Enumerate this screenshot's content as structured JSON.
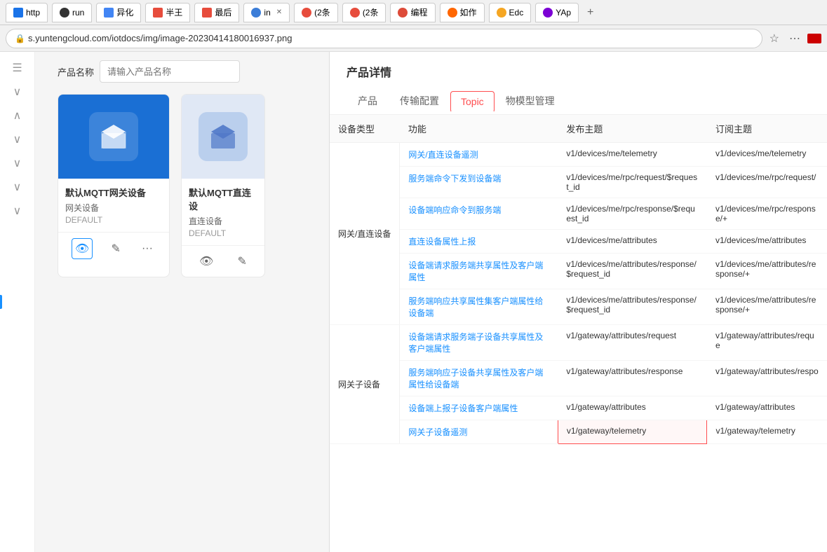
{
  "browser": {
    "tabs": [
      {
        "icon": "http",
        "label": "http",
        "closable": false
      },
      {
        "icon": "github",
        "label": "run",
        "closable": false
      },
      {
        "icon": "doc",
        "label": "异化",
        "closable": false
      },
      {
        "icon": "k",
        "label": "半王",
        "closable": false
      },
      {
        "icon": "k",
        "label": "最后",
        "closable": false
      },
      {
        "icon": "globe",
        "label": "in",
        "closable": true
      },
      {
        "icon": "c1",
        "label": "(2条",
        "closable": false
      },
      {
        "icon": "c1",
        "label": "(2条",
        "closable": false
      },
      {
        "icon": "g",
        "label": "编程",
        "closable": false
      },
      {
        "icon": "m",
        "label": "如作",
        "closable": false
      },
      {
        "icon": "edc",
        "label": "Edc",
        "closable": false
      },
      {
        "icon": "y",
        "label": "YAp",
        "closable": false
      }
    ],
    "address": "s.yuntengcloud.com/iotdocs/img/image-20230414180016937.png"
  },
  "left_panel": {
    "form_label": "产品名称",
    "form_placeholder": "请输入产品名称",
    "card1": {
      "title": "默认MQTT网关设备",
      "sub": "网关设备",
      "tag": "DEFAULT"
    },
    "card2": {
      "title": "默认MQTT直连设",
      "sub": "直连设备",
      "tag": "DEFAULT"
    }
  },
  "right_panel": {
    "title": "产品详情",
    "tabs": [
      {
        "label": "产品",
        "active": false
      },
      {
        "label": "传输配置",
        "active": false
      },
      {
        "label": "Topic",
        "active": true
      },
      {
        "label": "物模型管理",
        "active": false
      }
    ],
    "table": {
      "columns": [
        "设备类型",
        "功能",
        "发布主题",
        "订阅主题"
      ],
      "rows": [
        {
          "device_type": "",
          "device_type_rowspan": "",
          "func": "网关/直连设备遥测",
          "pub": "v1/devices/me/telemetry",
          "sub": "v1/devices/me/telemetry"
        },
        {
          "device_type": "",
          "func": "服务端命令下发到设备端",
          "pub": "v1/devices/me/rpc/request/$request_id",
          "sub": "v1/devices/me/rpc/request/"
        },
        {
          "device_type": "网关/直连设备",
          "func": "设备端响应命令到服务端",
          "pub": "v1/devices/me/rpc/response/$request_id",
          "sub": "v1/devices/me/rpc/response/+"
        },
        {
          "device_type": "",
          "func": "直连设备属性上报",
          "pub": "v1/devices/me/attributes",
          "sub": "v1/devices/me/attributes"
        },
        {
          "device_type": "",
          "func": "设备端请求服务端共享属性及客户端属性",
          "pub": "v1/devices/me/attributes/response/$request_id",
          "sub": "v1/devices/me/attributes/response/+"
        },
        {
          "device_type": "",
          "func": "服务端响应共享属性集客户端属性给设备端",
          "pub": "v1/devices/me/attributes/response/$request_id",
          "sub": "v1/devices/me/attributes/response/+"
        },
        {
          "device_type": "",
          "func": "设备端请求服务端子设备共享属性及客户端属性",
          "pub": "v1/gateway/attributes/request",
          "sub": "v1/gateway/attributes/reque"
        },
        {
          "device_type": "网关子设备",
          "func": "服务端响应子设备共享属性及客户端属性给设备端",
          "pub": "v1/gateway/attributes/response",
          "sub": "v1/gateway/attributes/respo"
        },
        {
          "device_type": "",
          "func": "设备端上报子设备客户端属性",
          "pub": "v1/gateway/attributes",
          "sub": "v1/gateway/attributes"
        },
        {
          "device_type": "",
          "func": "网关子设备遥测",
          "pub": "v1/gateway/telemetry",
          "sub": "v1/gateway/telemetry",
          "highlight_pub": true
        }
      ]
    }
  },
  "icons": {
    "hamburger": "☰",
    "eye": "👁",
    "edit": "✎",
    "more": "···",
    "star": "☆",
    "menu": "⋯",
    "collapse_down": "∨",
    "collapse_up": "∧",
    "zoom": "⊕"
  }
}
